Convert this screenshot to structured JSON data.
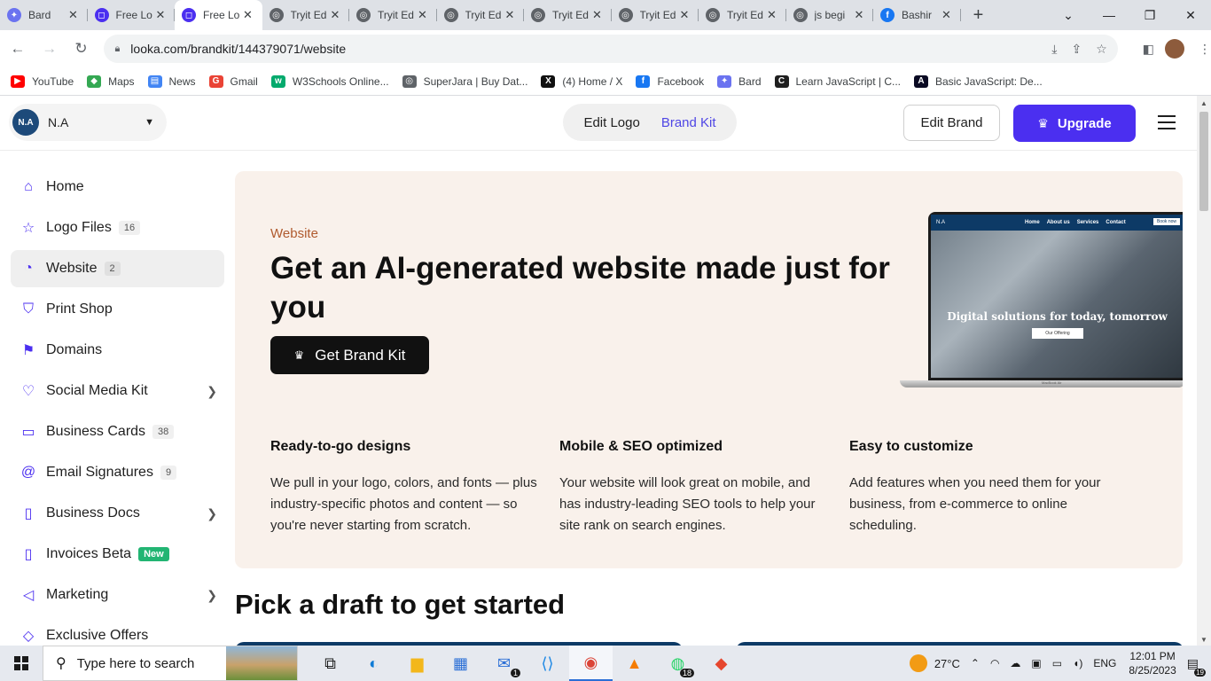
{
  "browser": {
    "tabs": [
      {
        "title": "Bard",
        "icon": "bard-icon",
        "color": "#6b73f0",
        "glyph": "✦"
      },
      {
        "title": "Free Lo",
        "icon": "looka-icon",
        "color": "#4b2ff0",
        "glyph": "◻"
      },
      {
        "title": "Free Lo",
        "icon": "looka-icon",
        "color": "#4b2ff0",
        "glyph": "◻",
        "active": true
      },
      {
        "title": "Tryit Ed",
        "icon": "globe-icon",
        "color": "#5f6368",
        "glyph": "◎"
      },
      {
        "title": "Tryit Ed",
        "icon": "globe-icon",
        "color": "#5f6368",
        "glyph": "◎"
      },
      {
        "title": "Tryit Ed",
        "icon": "globe-icon",
        "color": "#5f6368",
        "glyph": "◎"
      },
      {
        "title": "Tryit Ed",
        "icon": "globe-icon",
        "color": "#5f6368",
        "glyph": "◎"
      },
      {
        "title": "Tryit Ed",
        "icon": "globe-icon",
        "color": "#5f6368",
        "glyph": "◎"
      },
      {
        "title": "Tryit Ed",
        "icon": "globe-icon",
        "color": "#5f6368",
        "glyph": "◎"
      },
      {
        "title": "js begi",
        "icon": "globe-icon",
        "color": "#5f6368",
        "glyph": "◎"
      },
      {
        "title": "Bashir",
        "icon": "facebook-icon",
        "color": "#1877f2",
        "glyph": "f"
      }
    ],
    "url": "looka.com/brandkit/144379071/website",
    "bookmarks": [
      {
        "label": "YouTube",
        "icon": "youtube-icon",
        "color": "#ff0000",
        "glyph": "▶"
      },
      {
        "label": "Maps",
        "icon": "maps-icon",
        "color": "#34a853",
        "glyph": "◆"
      },
      {
        "label": "News",
        "icon": "news-icon",
        "color": "#4285f4",
        "glyph": "▤"
      },
      {
        "label": "Gmail",
        "icon": "google-icon",
        "color": "#ea4335",
        "glyph": "G"
      },
      {
        "label": "W3Schools Online...",
        "icon": "w3schools-icon",
        "color": "#04aa6d",
        "glyph": "w"
      },
      {
        "label": "SuperJara | Buy Dat...",
        "icon": "globe-icon",
        "color": "#5f6368",
        "glyph": "◎"
      },
      {
        "label": "(4) Home / X",
        "icon": "x-icon",
        "color": "#111111",
        "glyph": "X"
      },
      {
        "label": "Facebook",
        "icon": "facebook-icon",
        "color": "#1877f2",
        "glyph": "f"
      },
      {
        "label": "Bard",
        "icon": "bard-icon",
        "color": "#6b73f0",
        "glyph": "✦"
      },
      {
        "label": "Learn JavaScript | C...",
        "icon": "codecademy-icon",
        "color": "#1f1f1f",
        "glyph": "C"
      },
      {
        "label": "Basic JavaScript: De...",
        "icon": "freecodecamp-icon",
        "color": "#0a0a23",
        "glyph": "A"
      }
    ]
  },
  "header": {
    "brand_initials": "N.A",
    "brand_name": "N.A",
    "mode_edit_logo": "Edit Logo",
    "mode_brand_kit": "Brand Kit",
    "edit_brand": "Edit Brand",
    "upgrade": "Upgrade",
    "accent": "#4b2ff0"
  },
  "sidebar": {
    "items": [
      {
        "label": "Home",
        "icon": "home-icon",
        "glyph": "⌂"
      },
      {
        "label": "Logo Files",
        "icon": "star-icon",
        "glyph": "☆",
        "badge": "16"
      },
      {
        "label": "Website",
        "icon": "website-icon",
        "glyph": "◔",
        "badge": "2",
        "active": true
      },
      {
        "label": "Print Shop",
        "icon": "shirt-icon",
        "glyph": "⛉"
      },
      {
        "label": "Domains",
        "icon": "bookmark-icon",
        "glyph": "⚑"
      },
      {
        "label": "Social Media Kit",
        "icon": "heart-icon",
        "glyph": "♡",
        "arrow": true
      },
      {
        "label": "Business Cards",
        "icon": "cards-icon",
        "glyph": "▭",
        "badge": "38"
      },
      {
        "label": "Email Signatures",
        "icon": "at-icon",
        "glyph": "@",
        "badge": "9"
      },
      {
        "label": "Business Docs",
        "icon": "docs-icon",
        "glyph": "▯",
        "arrow": true
      },
      {
        "label": "Invoices Beta",
        "icon": "invoice-icon",
        "glyph": "▯",
        "badge": "New",
        "badge_new": true
      },
      {
        "label": "Marketing",
        "icon": "megaphone-icon",
        "glyph": "◁",
        "arrow": true
      },
      {
        "label": "Exclusive Offers",
        "icon": "tag-icon",
        "glyph": "◇"
      }
    ]
  },
  "hero": {
    "kicker": "Website",
    "title": "Get an AI-generated website made just for you",
    "cta": "Get Brand Kit",
    "preview": {
      "logo": "N.A",
      "nav": [
        "Home",
        "About us",
        "Services",
        "Contact"
      ],
      "book": "Book now",
      "headline": "Digital solutions for today, tomorrow",
      "button": "Our Offering",
      "laptop_label": "MacBook Air"
    },
    "features": [
      {
        "title": "Ready-to-go designs",
        "text": "We pull in your logo, colors, and fonts — plus industry-specific photos and content — so you're never starting from scratch."
      },
      {
        "title": "Mobile & SEO optimized",
        "text": "Your website will look great on mobile, and has industry-leading SEO tools to help your site rank on search engines."
      },
      {
        "title": "Easy to customize",
        "text": "Add features when you need them for your business, from e-commerce to online scheduling."
      }
    ]
  },
  "drafts": {
    "title": "Pick a draft to get started"
  },
  "taskbar": {
    "search_placeholder": "Type here to search",
    "apps": [
      {
        "name": "task-view-icon",
        "glyph": "⧉"
      },
      {
        "name": "edge-icon",
        "glyph": "◐",
        "color": "#0f7bd6"
      },
      {
        "name": "file-explorer-icon",
        "glyph": "▆",
        "color": "#f3b71b"
      },
      {
        "name": "store-icon",
        "glyph": "▦",
        "color": "#2b6fd6"
      },
      {
        "name": "mail-icon",
        "glyph": "✉",
        "color": "#2b6fd6",
        "count": "1"
      },
      {
        "name": "vscode-icon",
        "glyph": "⟨⟩",
        "color": "#1e88e5"
      },
      {
        "name": "chrome-icon",
        "glyph": "◉",
        "color": "#db4437",
        "active": true
      },
      {
        "name": "vlc-icon",
        "glyph": "▲",
        "color": "#f57c00"
      },
      {
        "name": "whatsapp-icon",
        "glyph": "◍",
        "color": "#25d366",
        "count": "18"
      },
      {
        "name": "app-drop-icon",
        "glyph": "◆",
        "color": "#e6462e"
      }
    ],
    "weather": "27°C",
    "language": "ENG",
    "time": "12:01 PM",
    "date": "8/25/2023",
    "notifications": "19"
  }
}
